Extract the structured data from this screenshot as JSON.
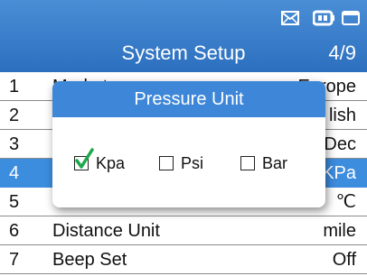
{
  "header": {
    "title": "System Setup",
    "page_indicator": "4/9",
    "status_icons": [
      "mail-icon",
      "battery-icon",
      "display-icon"
    ]
  },
  "rows": [
    {
      "num": "1",
      "label": "Market",
      "value": "Europe"
    },
    {
      "num": "2",
      "label": "",
      "value": "lish"
    },
    {
      "num": "3",
      "label": "",
      "value": "Dec"
    },
    {
      "num": "4",
      "label": "",
      "value": "KPa"
    },
    {
      "num": "5",
      "label": "",
      "value": "℃"
    },
    {
      "num": "6",
      "label": "Distance Unit",
      "value": "mile"
    },
    {
      "num": "7",
      "label": "Beep Set",
      "value": "Off"
    }
  ],
  "selected_row": 3,
  "dialog": {
    "title": "Pressure Unit",
    "options": [
      {
        "label": "Kpa",
        "checked": true
      },
      {
        "label": "Psi",
        "checked": false
      },
      {
        "label": "Bar",
        "checked": false
      }
    ]
  },
  "colors": {
    "header": "#2c6fbf",
    "selected_row": "#3d8ddf",
    "dialog_title": "#3d86d8",
    "check_mark": "#1aa84a"
  }
}
